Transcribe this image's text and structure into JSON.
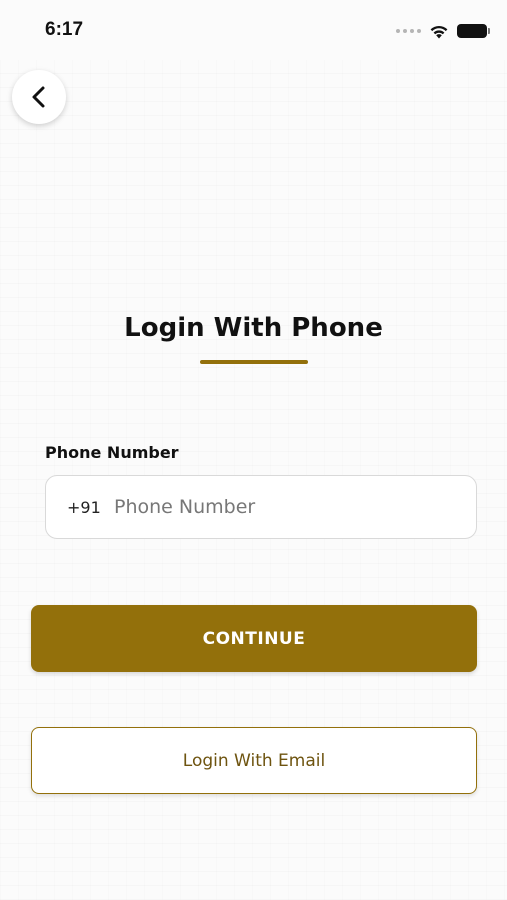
{
  "status_bar": {
    "time": "6:17",
    "icons": [
      "signal-dots-icon",
      "wifi-icon",
      "battery-icon"
    ]
  },
  "header": {
    "back_icon": "chevron-left-icon"
  },
  "login": {
    "title": "Login With Phone",
    "phone_label": "Phone Number",
    "country_code": "+91",
    "phone_placeholder": "Phone Number",
    "phone_value": "",
    "continue_label": "CONTINUE",
    "email_label": "Login With Email"
  },
  "colors": {
    "accent": "#93700b",
    "accent_text": "#6e5410",
    "background": "#fbfbfb",
    "field_border": "#d9d9d9"
  }
}
